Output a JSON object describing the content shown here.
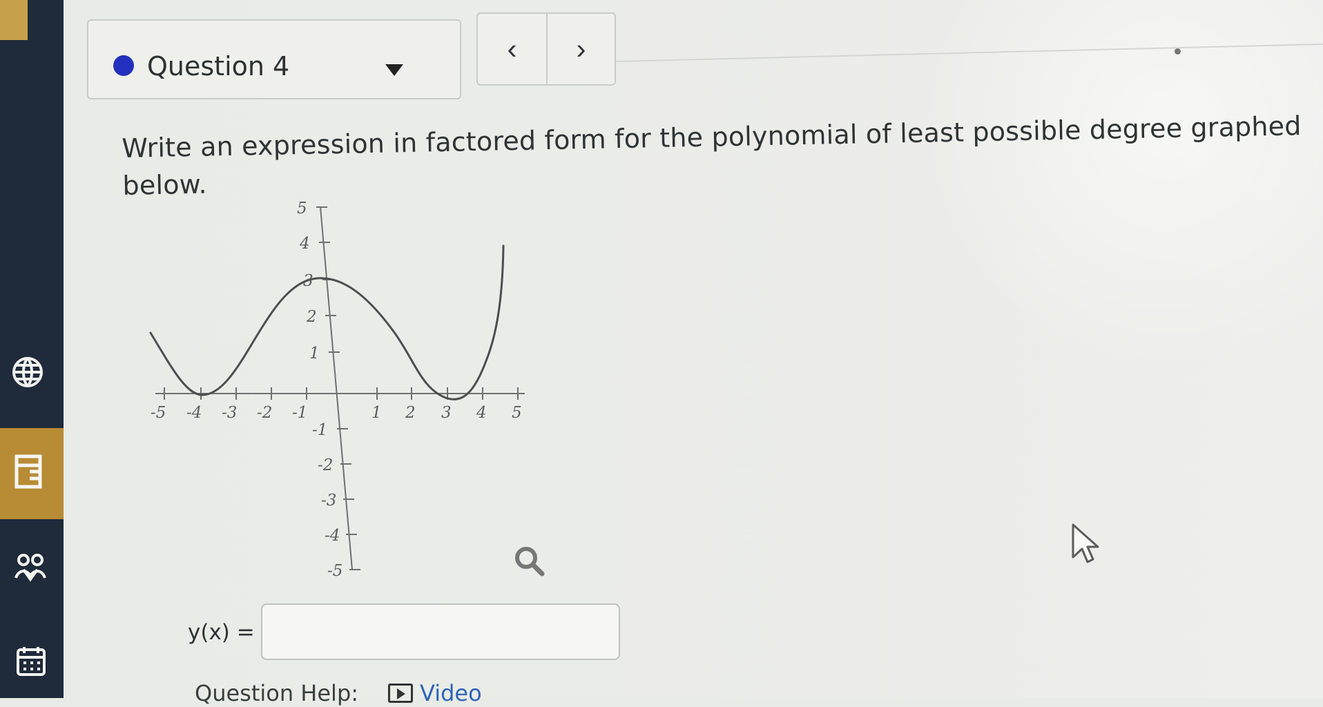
{
  "question": {
    "label": "Question 4",
    "prompt": "Write an expression in factored form for the polynomial of least possible degree graphed below."
  },
  "answer": {
    "label": "y(x) =",
    "value": ""
  },
  "help": {
    "label": "Question Help:",
    "video_label": "Video"
  },
  "graph": {
    "x_ticks": [
      "-5",
      "-4",
      "-3",
      "-2",
      "-1",
      "1",
      "2",
      "3",
      "4",
      "5"
    ],
    "y_ticks": [
      "5",
      "4",
      "3",
      "2",
      "1",
      "-1",
      "-2",
      "-3",
      "-4",
      "-5"
    ]
  },
  "colors": {
    "question_dot": "#2330bd",
    "sidebar": "#1f2a3a",
    "sidebar_accent": "#b88b35",
    "link": "#2d64b8"
  },
  "icons": {
    "previous": "chevron-left-icon",
    "next": "chevron-right-icon",
    "dropdown": "chevron-down-icon",
    "zoom": "magnifier-icon",
    "video": "video-icon"
  }
}
